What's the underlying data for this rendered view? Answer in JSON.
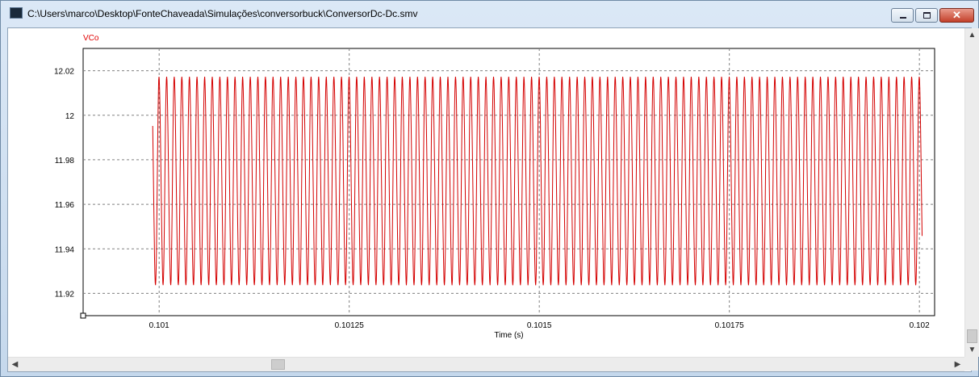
{
  "window": {
    "title": "C:\\Users\\marco\\Desktop\\FonteChaveada\\Simulações\\conversorbuck\\ConversorDc-Dc.smv",
    "controls": {
      "minimize_icon": "minimize-icon",
      "maximize_icon": "maximize-icon",
      "close_icon": "close-icon"
    }
  },
  "scrollbars": {
    "vertical": {
      "up_icon": "chevron-up-icon",
      "down_icon": "chevron-down-icon"
    },
    "horizontal": {
      "left_icon": "chevron-left-icon",
      "right_icon": "chevron-right-icon"
    }
  },
  "colors": {
    "trace": "#d40000",
    "legend": "#e00000",
    "grid": "#808080"
  },
  "chart_data": {
    "type": "line",
    "series": [
      {
        "name": "VCo",
        "color": "#d40000",
        "waveform": "periodic ripple",
        "period_s": 1e-05,
        "min": 11.924,
        "max": 12.017,
        "x_start": 0.101,
        "x_end": 0.102
      }
    ],
    "xlabel": "Time (s)",
    "ylabel": "",
    "xlim": [
      0.1009,
      0.10202
    ],
    "ylim": [
      11.91,
      12.03
    ],
    "xticks": [
      0.101,
      0.10125,
      0.1015,
      0.10175,
      0.102
    ],
    "xtick_labels": [
      "0.101",
      "0.10125",
      "0.1015",
      "0.10175",
      "0.102"
    ],
    "yticks": [
      11.92,
      11.94,
      11.96,
      11.98,
      12,
      12.02
    ],
    "ytick_labels": [
      "11.92",
      "11.94",
      "11.96",
      "11.98",
      "12",
      "12.02"
    ],
    "grid": true,
    "legend": "top-left"
  }
}
